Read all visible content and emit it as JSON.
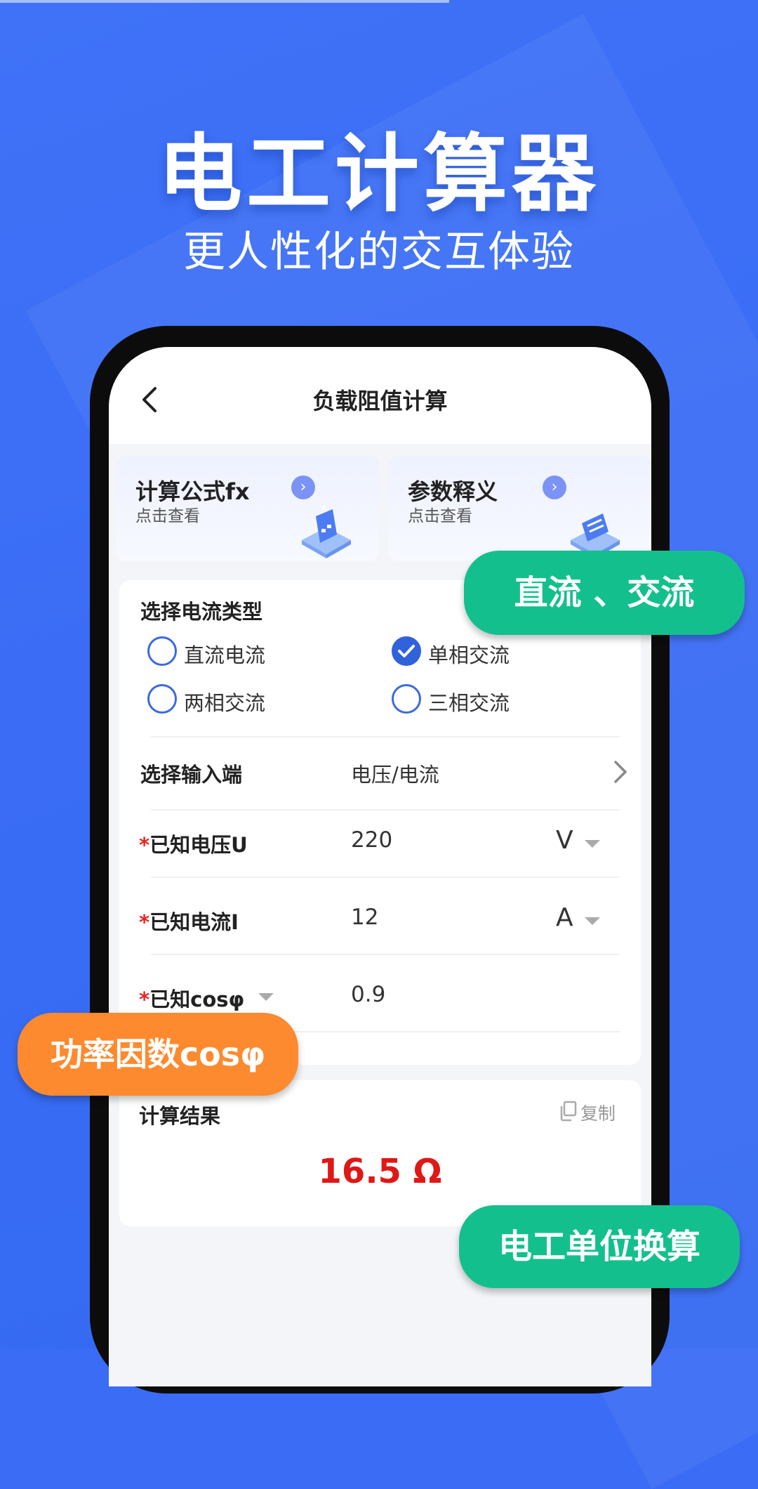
{
  "promo": {
    "title": "电工计算器",
    "subtitle": "更人性化的交互体验"
  },
  "app": {
    "title": "负载阻值计算",
    "cards": [
      {
        "title": "计算公式fx",
        "subtitle": "点击查看"
      },
      {
        "title": "参数释义",
        "subtitle": "点击查看"
      }
    ],
    "current_type": {
      "label": "选择电流类型",
      "options": [
        {
          "label": "直流电流",
          "checked": false
        },
        {
          "label": "单相交流",
          "checked": true
        },
        {
          "label": "两相交流",
          "checked": false
        },
        {
          "label": "三相交流",
          "checked": false
        }
      ]
    },
    "input_select": {
      "label": "选择输入端",
      "value": "电压/电流"
    },
    "fields": [
      {
        "required": "*",
        "label": "已知电压U",
        "value": "220",
        "unit": "V"
      },
      {
        "required": "*",
        "label": "已知电流I",
        "value": "12",
        "unit": "A"
      },
      {
        "required": "*",
        "label": "已知cosφ",
        "value": "0.9"
      }
    ],
    "result": {
      "label": "计算结果",
      "copy": "复制",
      "value": "16.5 Ω"
    }
  },
  "badges": {
    "dc_ac": "直流 、交流",
    "power_factor": "功率因数cosφ",
    "unit_convert": "电工单位换算"
  },
  "colors": {
    "background": "#3a6cf5",
    "accent_blue": "#2f62db",
    "result_red": "#e01717",
    "badge_green": "#14bf8e",
    "badge_orange": "#fd8a2e"
  }
}
